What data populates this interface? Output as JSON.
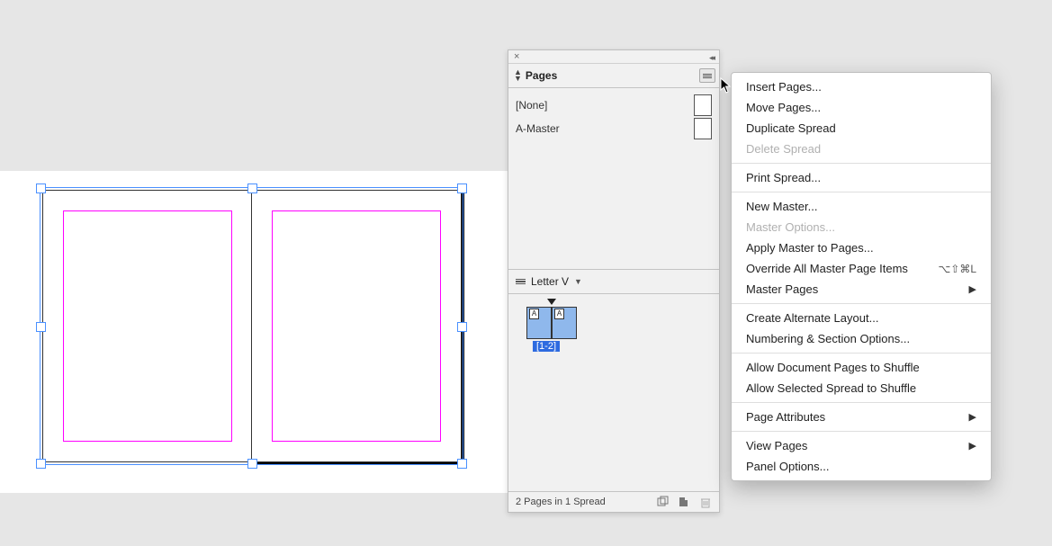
{
  "canvas": {
    "spread_pages": 2
  },
  "panel": {
    "tab_label": "Pages",
    "masters": [
      {
        "label": "[None]",
        "has_thumb": true
      },
      {
        "label": "A-Master",
        "has_thumb": true
      }
    ],
    "layout_name": "Letter V",
    "spread": {
      "page_left_prefix": "A",
      "page_right_prefix": "A",
      "range_label": "[1-2]"
    },
    "footer_status": "2 Pages in 1 Spread"
  },
  "menu": {
    "groups": [
      [
        {
          "label": "Insert Pages...",
          "disabled": false
        },
        {
          "label": "Move Pages...",
          "disabled": false
        },
        {
          "label": "Duplicate Spread",
          "disabled": false
        },
        {
          "label": "Delete Spread",
          "disabled": true
        }
      ],
      [
        {
          "label": "Print Spread...",
          "disabled": false
        }
      ],
      [
        {
          "label": "New Master...",
          "disabled": false
        },
        {
          "label": "Master Options...",
          "disabled": true
        },
        {
          "label": "Apply Master to Pages...",
          "disabled": false
        },
        {
          "label": "Override All Master Page Items",
          "disabled": false,
          "shortcut": "⌥⇧⌘L"
        },
        {
          "label": "Master Pages",
          "disabled": false,
          "submenu": true
        }
      ],
      [
        {
          "label": "Create Alternate Layout...",
          "disabled": false
        },
        {
          "label": "Numbering & Section Options...",
          "disabled": false
        }
      ],
      [
        {
          "label": "Allow Document Pages to Shuffle",
          "disabled": false
        },
        {
          "label": "Allow Selected Spread to Shuffle",
          "disabled": false
        }
      ],
      [
        {
          "label": "Page Attributes",
          "disabled": false,
          "submenu": true
        }
      ],
      [
        {
          "label": "View Pages",
          "disabled": false,
          "submenu": true
        },
        {
          "label": "Panel Options...",
          "disabled": false
        }
      ]
    ]
  }
}
